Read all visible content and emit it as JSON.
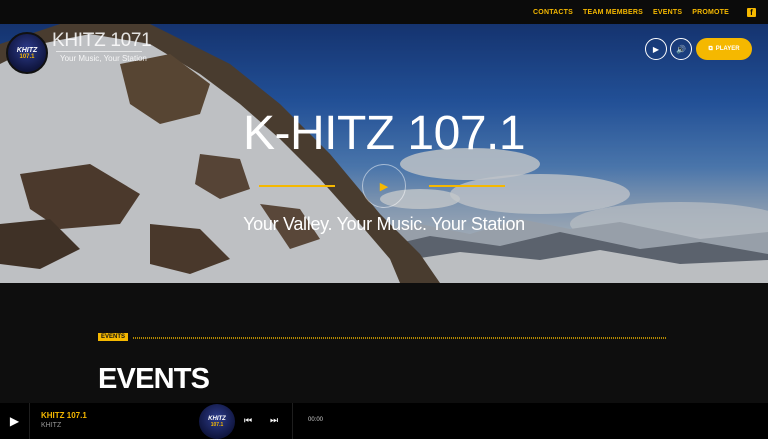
{
  "nav": {
    "items": [
      {
        "label": "CONTACTS"
      },
      {
        "label": "TEAM MEMBERS"
      },
      {
        "label": "EVENTS"
      },
      {
        "label": "PROMOTE"
      }
    ],
    "social_icon": "facebook-icon",
    "accent": "#f5b800"
  },
  "brand": {
    "logo_text": "KHITZ",
    "logo_freq": "107.1",
    "name": "KHITZ 1071",
    "tagline": "Your Music, Your Station"
  },
  "hero": {
    "title": "K-HITZ 107.1",
    "subtitle": "Your Valley. Your Music. Your Station",
    "player_label": "PLAYER",
    "play_icon": "play-icon",
    "volume_icon": "volume-icon"
  },
  "events": {
    "tag": "EVENTS",
    "heading": "EVENTS"
  },
  "player_bar": {
    "station": "KHITZ 107.1",
    "artist": "KHITZ",
    "art_text": "KHITZ",
    "art_freq": "107.1",
    "time": "00:00"
  }
}
